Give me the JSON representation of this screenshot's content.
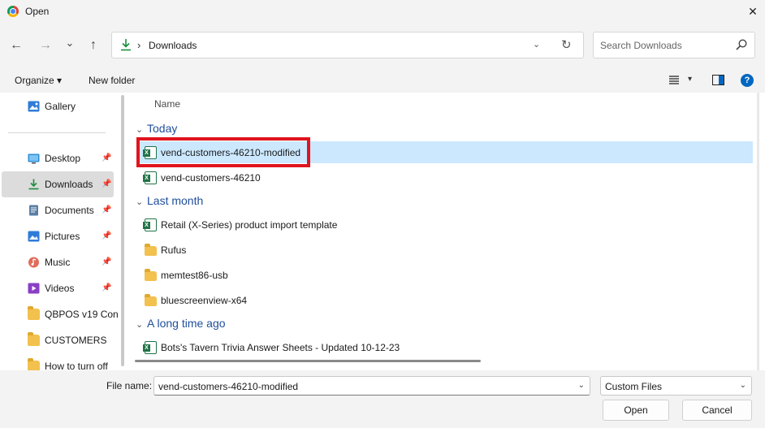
{
  "window": {
    "title": "Open",
    "close_glyph": "✕"
  },
  "nav": {
    "back_glyph": "←",
    "forward_glyph": "→",
    "recent_glyph": "⌄",
    "up_glyph": "↑",
    "address": {
      "separator": "›",
      "location": "Downloads",
      "dropdown_glyph": "⌄",
      "refresh_glyph": "↻"
    },
    "search": {
      "placeholder": "Search Downloads"
    }
  },
  "commands": {
    "organize": "Organize ▾",
    "new_folder": "New folder",
    "view_dropdown_glyph": "▾",
    "help_glyph": "?"
  },
  "sidebar": {
    "items": [
      {
        "label": "Gallery",
        "icon": "gallery-icon",
        "pinned": false,
        "active": false
      },
      {
        "label": "Desktop",
        "icon": "desktop-icon",
        "pinned": true,
        "active": false
      },
      {
        "label": "Downloads",
        "icon": "download-icon",
        "pinned": true,
        "active": true
      },
      {
        "label": "Documents",
        "icon": "documents-icon",
        "pinned": true,
        "active": false
      },
      {
        "label": "Pictures",
        "icon": "pictures-icon",
        "pinned": true,
        "active": false
      },
      {
        "label": "Music",
        "icon": "music-icon",
        "pinned": true,
        "active": false
      },
      {
        "label": "Videos",
        "icon": "videos-icon",
        "pinned": true,
        "active": false
      },
      {
        "label": "QBPOS v19 Con",
        "icon": "folder-icon",
        "pinned": false,
        "active": false
      },
      {
        "label": "CUSTOMERS",
        "icon": "folder-icon",
        "pinned": false,
        "active": false
      },
      {
        "label": "How to turn off",
        "icon": "folder-icon",
        "pinned": false,
        "active": false
      }
    ],
    "pin_glyph": "📌"
  },
  "file_list": {
    "column_header": "Name",
    "group_chevron": "⌄",
    "groups": [
      {
        "label": "Today",
        "files": [
          {
            "name": "vend-customers-46210-modified",
            "type": "excel",
            "selected": true
          },
          {
            "name": "vend-customers-46210",
            "type": "excel",
            "selected": false
          }
        ]
      },
      {
        "label": "Last month",
        "files": [
          {
            "name": "Retail (X-Series) product import template",
            "type": "excel",
            "selected": false
          },
          {
            "name": "Rufus",
            "type": "folder",
            "selected": false
          },
          {
            "name": "memtest86-usb",
            "type": "folder",
            "selected": false
          },
          {
            "name": "bluescreenview-x64",
            "type": "folder",
            "selected": false
          }
        ]
      },
      {
        "label": "A long time ago",
        "files": [
          {
            "name": "Bots's Tavern Trivia Answer Sheets - Updated 10-12-23",
            "type": "excel",
            "selected": false
          }
        ]
      }
    ]
  },
  "footer": {
    "file_name_label": "File name:",
    "file_name_value": "vend-customers-46210-modified",
    "file_name_dropdown_glyph": "⌄",
    "file_type_value": "Custom Files",
    "file_type_dropdown_glyph": "⌄",
    "open_label": "Open",
    "cancel_label": "Cancel"
  },
  "colors": {
    "accent": "#0067c0",
    "selection": "#cce8ff",
    "highlight_box": "#e0141e",
    "group_header": "#1f4e9c",
    "chrome_bg": "#f3f3f3"
  }
}
